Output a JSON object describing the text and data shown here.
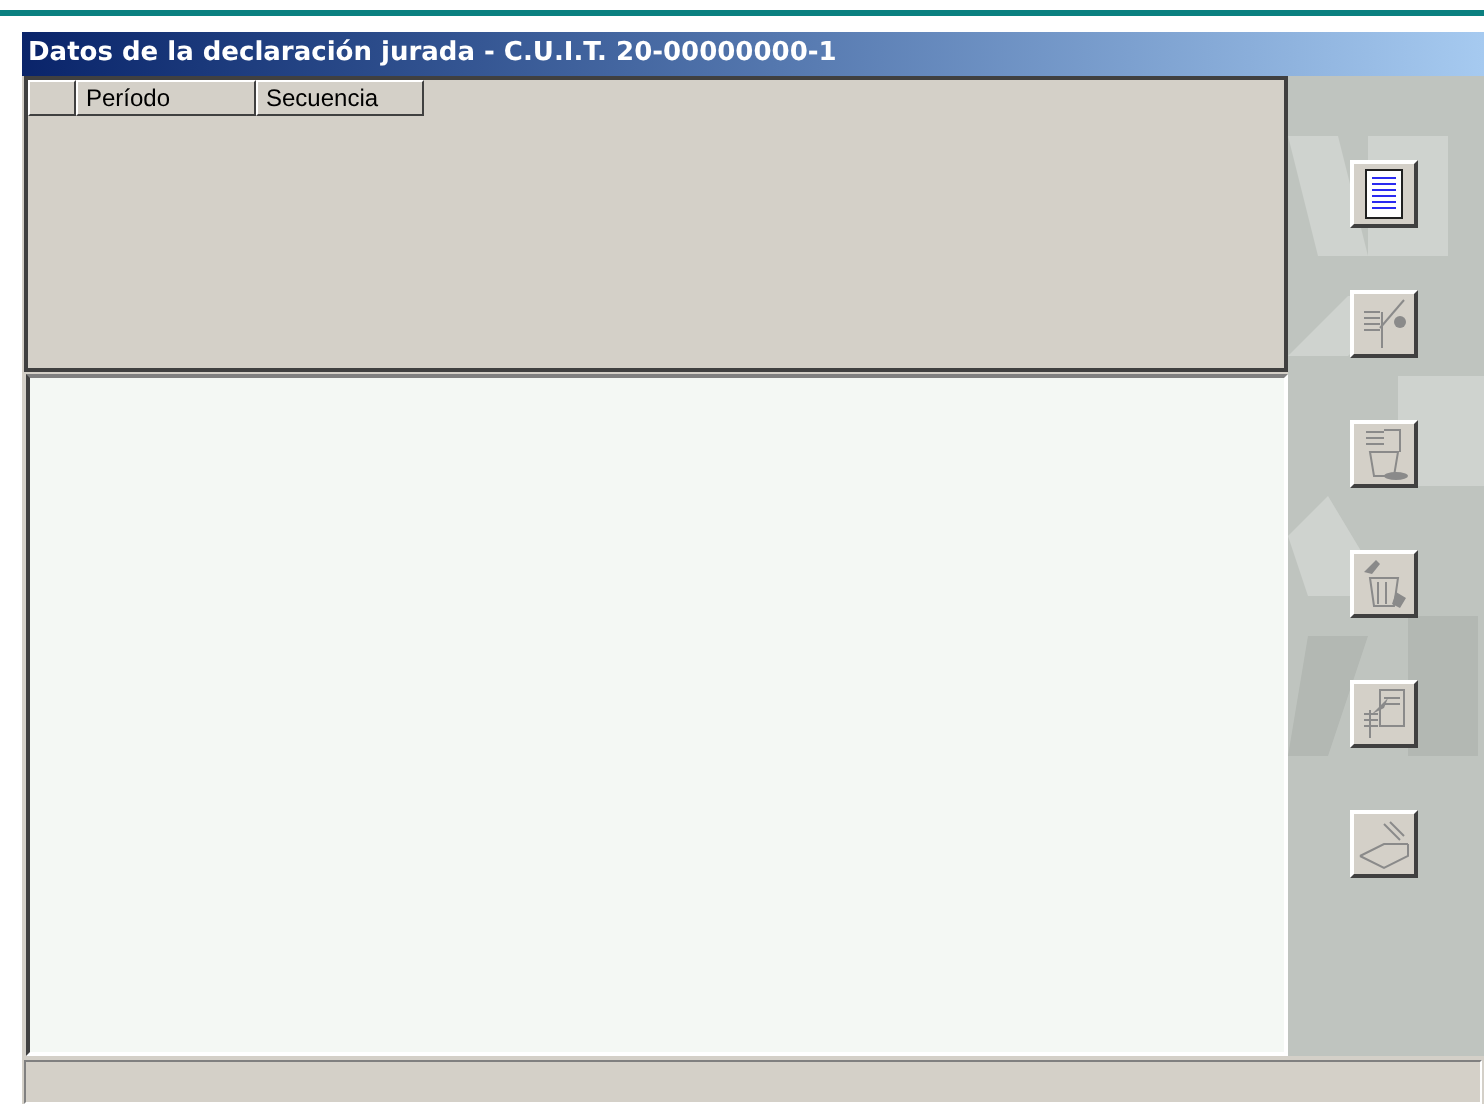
{
  "window": {
    "title": "Datos de la declaración jurada - C.U.I.T. 20-00000000-1"
  },
  "grid": {
    "columns": [
      "Período",
      "Secuencia"
    ]
  },
  "toolbar": {
    "buttons": [
      {
        "kind": "list",
        "disabled": false
      },
      {
        "kind": "edit",
        "disabled": true
      },
      {
        "kind": "delete",
        "disabled": true
      },
      {
        "kind": "purge",
        "disabled": true
      },
      {
        "kind": "export",
        "disabled": true
      },
      {
        "kind": "print",
        "disabled": true
      }
    ]
  }
}
